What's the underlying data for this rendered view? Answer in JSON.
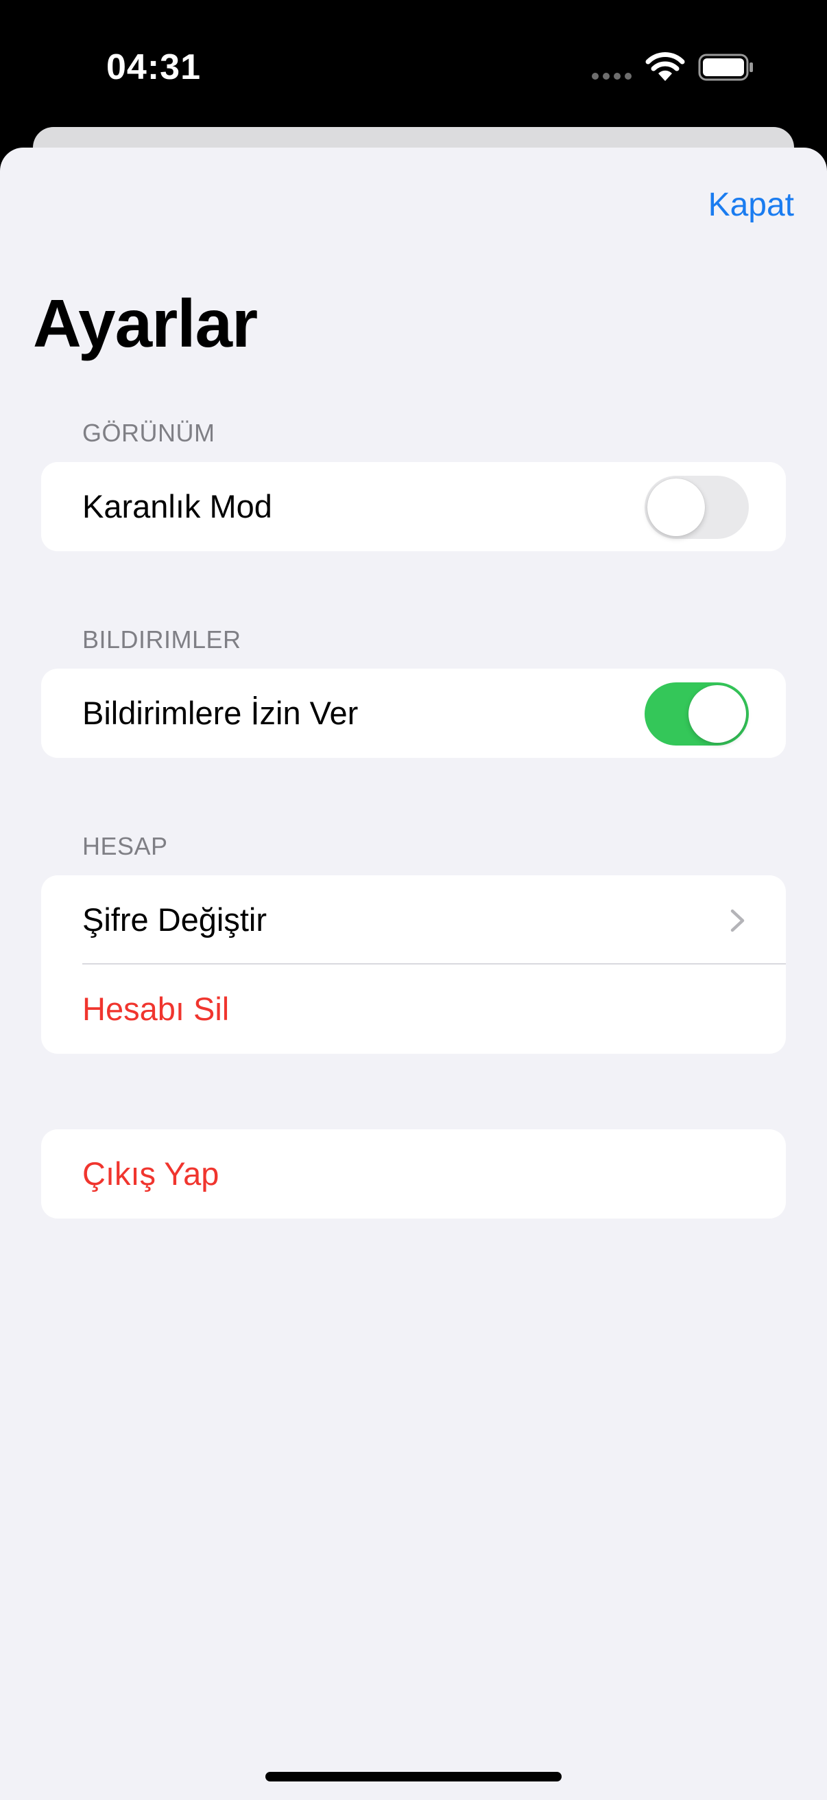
{
  "status_bar": {
    "time": "04:31"
  },
  "sheet": {
    "close_label": "Kapat",
    "title": "Ayarlar"
  },
  "sections": {
    "appearance": {
      "header": "GÖRÜNÜM",
      "dark_mode": {
        "label": "Karanlık Mod",
        "on": false
      }
    },
    "notifications": {
      "header": "BILDIRIMLER",
      "allow": {
        "label": "Bildirimlere İzin Ver",
        "on": true
      }
    },
    "account": {
      "header": "HESAP",
      "change_password": "Şifre Değiştir",
      "delete_account": "Hesabı Sil"
    },
    "logout": {
      "label": "Çıkış Yap"
    }
  },
  "colors": {
    "accent": "#1a7cf0",
    "destructive": "#f0352e",
    "toggle_on": "#34c759",
    "toggle_off": "#e9e9eb",
    "background": "#f2f2f7"
  },
  "icons": [
    "wifi-icon",
    "battery-icon",
    "cellular-signal-icon",
    "chevron-right-icon"
  ]
}
